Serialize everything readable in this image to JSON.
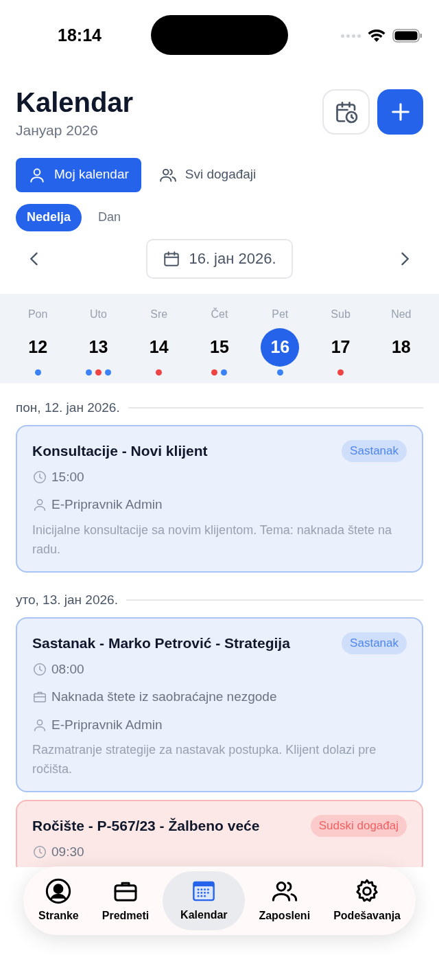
{
  "status_bar": {
    "time": "18:14"
  },
  "header": {
    "title": "Kalendar",
    "subtitle": "Јануар 2026"
  },
  "scope_tabs": [
    {
      "label": "Moj kalendar",
      "selected": true
    },
    {
      "label": "Svi događaji",
      "selected": false
    }
  ],
  "view_tabs": [
    {
      "label": "Nedelja",
      "selected": true
    },
    {
      "label": "Dan",
      "selected": false
    }
  ],
  "date_picker": {
    "value": "16. јан 2026."
  },
  "week": [
    {
      "weekday": "Pon",
      "day": "12",
      "selected": false,
      "dots": [
        {
          "color": "#3b82f6"
        }
      ]
    },
    {
      "weekday": "Uto",
      "day": "13",
      "selected": false,
      "dots": [
        {
          "color": "#3b82f6"
        },
        {
          "color": "#ef4444"
        },
        {
          "color": "#3b82f6"
        }
      ]
    },
    {
      "weekday": "Sre",
      "day": "14",
      "selected": false,
      "dots": [
        {
          "color": "#ef4444"
        }
      ]
    },
    {
      "weekday": "Čet",
      "day": "15",
      "selected": false,
      "dots": [
        {
          "color": "#ef4444"
        },
        {
          "color": "#3b82f6"
        }
      ]
    },
    {
      "weekday": "Pet",
      "day": "16",
      "selected": true,
      "dots": [
        {
          "color": "#3b82f6"
        }
      ]
    },
    {
      "weekday": "Sub",
      "day": "17",
      "selected": false,
      "dots": [
        {
          "color": "#ef4444"
        }
      ]
    },
    {
      "weekday": "Ned",
      "day": "18",
      "selected": false
    }
  ],
  "days": [
    {
      "date": "пон, 12. јан 2026.",
      "events": [
        {
          "kind": "meeting",
          "title": "Konsultacije - Novi klijent",
          "badge": "Sastanak",
          "time": "15:00",
          "person": "E-Pripravnik Admin",
          "description": "Inicijalne konsultacije sa novim klijentom. Tema: naknada štete na radu."
        }
      ]
    },
    {
      "date": "уто, 13. јан 2026.",
      "events": [
        {
          "kind": "meeting",
          "title": "Sastanak - Marko Petrović - Strategija",
          "badge": "Sastanak",
          "time": "08:00",
          "case": "Naknada štete iz saobraćajne nezgode",
          "person": "E-Pripravnik Admin",
          "description": "Razmatranje strategije za nastavak postupka. Klijent dolazi pre ročišta."
        },
        {
          "kind": "court",
          "title": "Ročište - P-567/23 - Žalbeno veće",
          "badge": "Sudski događaj",
          "time": "09:30"
        }
      ]
    }
  ],
  "tab_bar": [
    {
      "label": "Stranke",
      "selected": false
    },
    {
      "label": "Predmeti",
      "selected": false
    },
    {
      "label": "Kalendar",
      "selected": true
    },
    {
      "label": "Zaposleni",
      "selected": false
    },
    {
      "label": "Podešavanja",
      "selected": false
    }
  ]
}
